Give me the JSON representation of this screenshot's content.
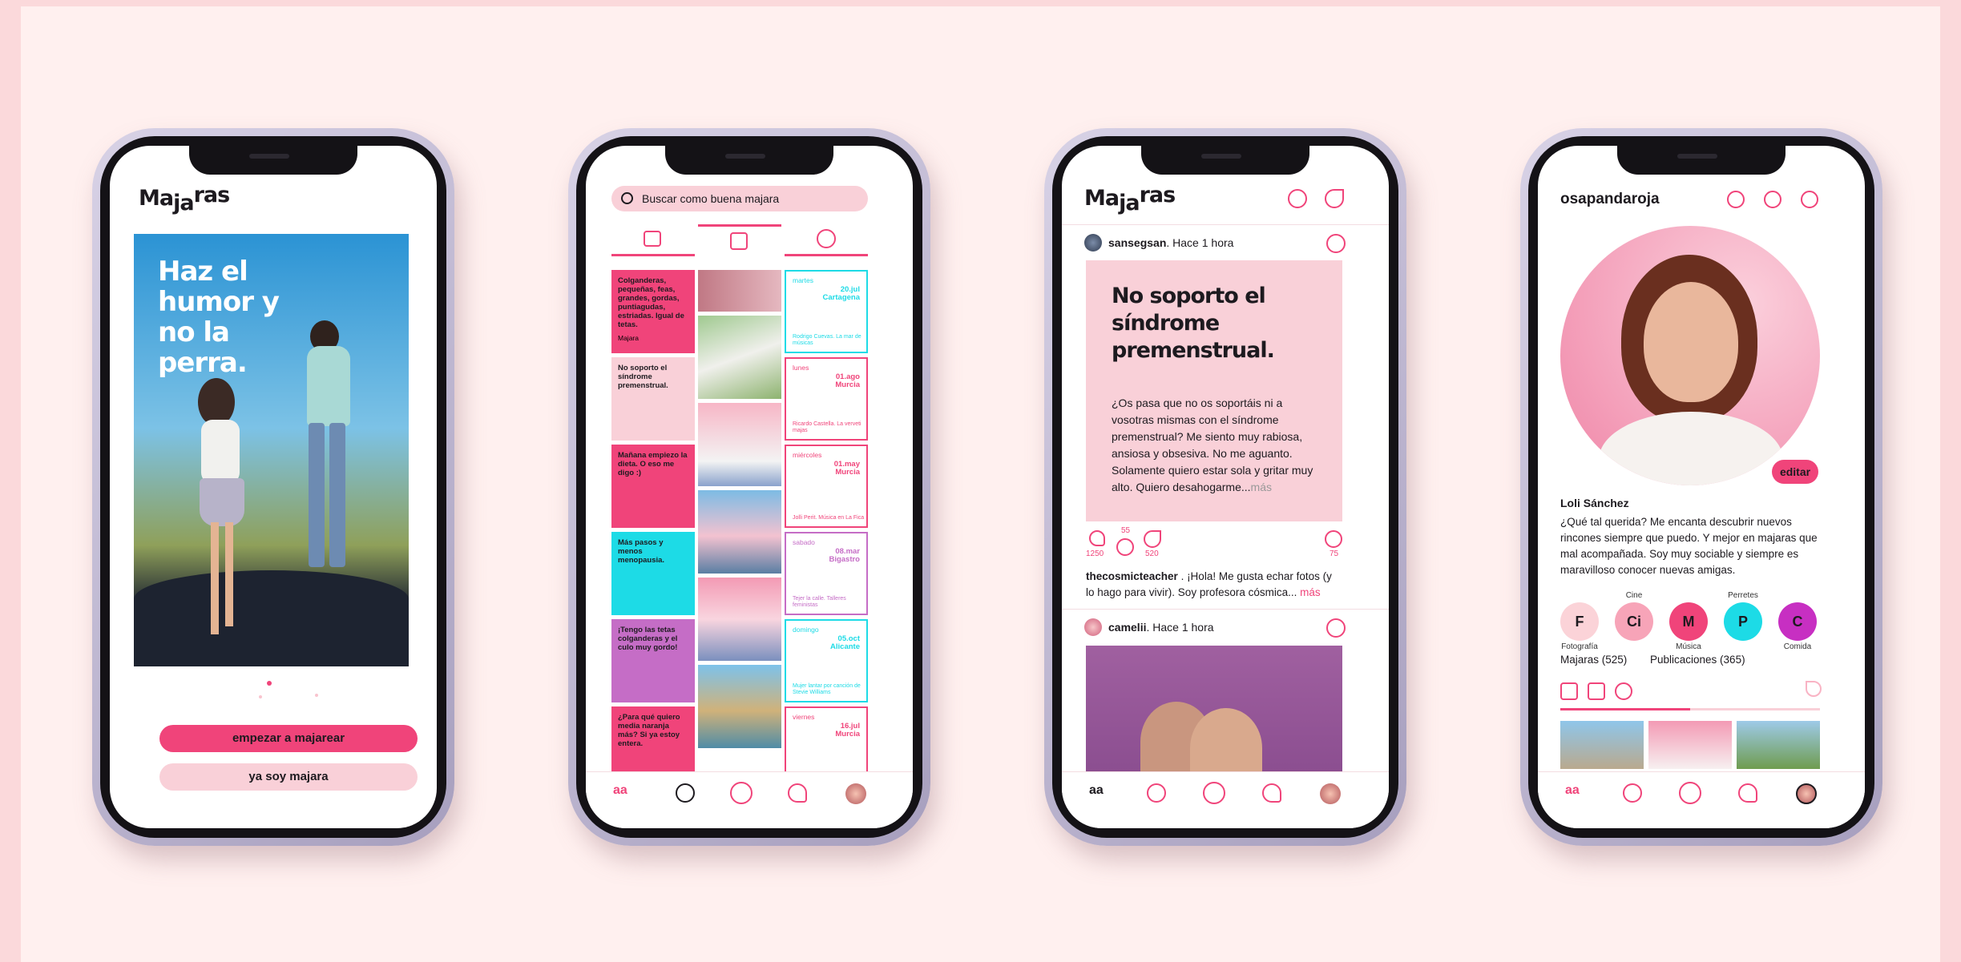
{
  "brand": {
    "logo_a": "Ma",
    "logo_b": "ja",
    "logo_c": "ras",
    "accent": "#f0447a",
    "light_pink": "#f9d0d8",
    "cyan": "#1ddbe6"
  },
  "screen1": {
    "headline": [
      "Haz el",
      "humor y",
      "no la",
      "perra."
    ],
    "primary_button": "empezar a majarear",
    "secondary_button": "ya soy majara"
  },
  "screen2": {
    "search_placeholder": "Buscar como buena majara",
    "tabs": [
      "text-icon",
      "image-icon",
      "spiral-icon"
    ],
    "text_tiles": [
      {
        "title": "Colganderas, pequeñas, feas, grandes, gordas, puntiagudas, estriadas. Igual de tetas.",
        "bg": "#f0447a",
        "footer": "Majara"
      },
      {
        "title": "No soporto el síndrome premenstrual.",
        "bg": "#f9d0d8"
      },
      {
        "title": "Mañana empiezo la dieta. O eso me digo :)",
        "bg": "#f0447a"
      },
      {
        "title": "Más pasos y menos menopausia.",
        "bg": "#1ddbe6"
      },
      {
        "title": "¡Tengo las tetas colganderas y el culo muy gordo!",
        "bg": "#c56dc6"
      },
      {
        "title": "¿Para qué quiero media naranja más? Si ya estoy entera.",
        "bg": "#f0447a"
      }
    ],
    "events": [
      {
        "day": "martes",
        "date": "20.jul",
        "city": "Cartagena",
        "color": "#1ddbe6",
        "sub": "Rodrigo Cuevas. La mar de músicas"
      },
      {
        "day": "lunes",
        "date": "01.ago",
        "city": "Murcia",
        "color": "#f0447a",
        "sub": "Ricardo Castella. La verveti majas"
      },
      {
        "day": "miércoles",
        "date": "01.may",
        "city": "Murcia",
        "color": "#f0447a",
        "sub": "Jolli Perit. Música en La Fica"
      },
      {
        "day": "sabado",
        "date": "08.mar",
        "city": "Bigastro",
        "color": "#c56dc6",
        "sub": "Tejer la calle. Talleres feministas"
      },
      {
        "day": "domingo",
        "date": "05.oct",
        "city": "Alicante",
        "color": "#1ddbe6",
        "sub": "Mujer lantar por canción de Stevie Williams"
      },
      {
        "day": "viernes",
        "date": "16.jul",
        "city": "Murcia",
        "color": "#f0447a",
        "sub": ""
      }
    ]
  },
  "screen3": {
    "post1": {
      "user": "sansegsan",
      "time": ". Hace 1 hora",
      "title": "No soporto el síndrome premenstrual.",
      "body": "¿Os pasa que no os soportáis ni a vosotras mismas con el síndrome premenstrual? Me siento muy rabiosa, ansiosa y obsesiva. No me aguanto. Solamente quiero estar sola y gritar muy alto. Quiero desahogarme...",
      "more": "más",
      "likes": "1250",
      "comments": "55",
      "shares": "520",
      "reactions": "75"
    },
    "comment": {
      "user": "thecosmicteacher",
      "text": " . ¡Hola! Me gusta echar fotos (y lo hago para vivir). Soy profesora cósmica...",
      "more": "más"
    },
    "post2": {
      "user": "camelii",
      "time": ". Hace 1 hora"
    }
  },
  "screen4": {
    "username": "osapandaroja",
    "edit": "editar",
    "name": "Loli Sánchez",
    "bio": "¿Qué tal querida? Me encanta descubrir nuevos rincones siempre que puedo. Y mejor en majaras que mal acompañada. Soy muy sociable y siempre es maravilloso conocer nuevas amigas.",
    "interests": [
      {
        "letter": "F",
        "top": "",
        "bottom": "Fotografía",
        "color": "#fbd3d8"
      },
      {
        "letter": "Ci",
        "top": "Cine",
        "bottom": "",
        "color": "#f7a4b8"
      },
      {
        "letter": "M",
        "top": "",
        "bottom": "Música",
        "color": "#f0447a"
      },
      {
        "letter": "P",
        "top": "Perretes",
        "bottom": "",
        "color": "#1ddbe6"
      },
      {
        "letter": "C",
        "top": "",
        "bottom": "Comida",
        "color": "#c72fc2"
      }
    ],
    "followers": "Majaras (525)",
    "posts": "Publicaciones (365)"
  }
}
